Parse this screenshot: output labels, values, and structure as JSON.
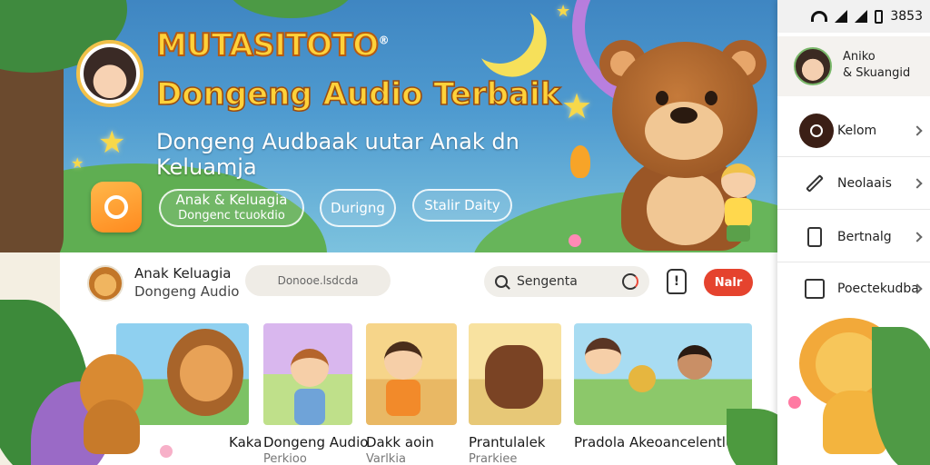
{
  "hero": {
    "brand": "MUTASITOTO",
    "brand_mark": "®",
    "headline": "Dongeng Audio Terbaik",
    "subline": "Dongeng Audbaak uutar Anak dn Keluamja",
    "buttons": [
      {
        "label": "Anak & Keluagia",
        "sublabel": "Dongenc tcuokdio"
      },
      {
        "label": "Durigng"
      },
      {
        "label": "Stalir Daity"
      }
    ]
  },
  "profile": {
    "name": "Anak Keluagia",
    "subtitle": "Dongeng Audio"
  },
  "toolbar": {
    "pill_field": "Donooe.lsdcda",
    "search_value": "Sengenta",
    "notification_glyph": "!",
    "cta_label": "Nalr"
  },
  "cards": [
    {
      "title": "",
      "subtitle": ""
    },
    {
      "title": "Dongeng Audio",
      "subtitle": "Perkioo"
    },
    {
      "title": "Dakk aoin",
      "subtitle": "Varlkia"
    },
    {
      "title": "Prantulalek",
      "subtitle": "Prarkiee"
    },
    {
      "title": "Pradola Akeoancelentlus",
      "subtitle": ""
    }
  ],
  "card_overflow_label": "Kaka",
  "sidebar": {
    "status_time": "3853",
    "account_line1": "Aniko",
    "account_line2": "& Skuangid",
    "items": [
      {
        "label": "Kelom",
        "icon": "search-icon"
      },
      {
        "label": "Neolaais",
        "icon": "pen-icon"
      },
      {
        "label": "Bertnalg",
        "icon": "document-icon"
      },
      {
        "label": "Poectekudba",
        "icon": "edit-box-icon"
      }
    ]
  },
  "colors": {
    "brand_yellow": "#ffd23a",
    "sky_blue": "#4f9bd0",
    "cta_red": "#e5432e",
    "app_icon_orange": "#ff9a2a"
  }
}
